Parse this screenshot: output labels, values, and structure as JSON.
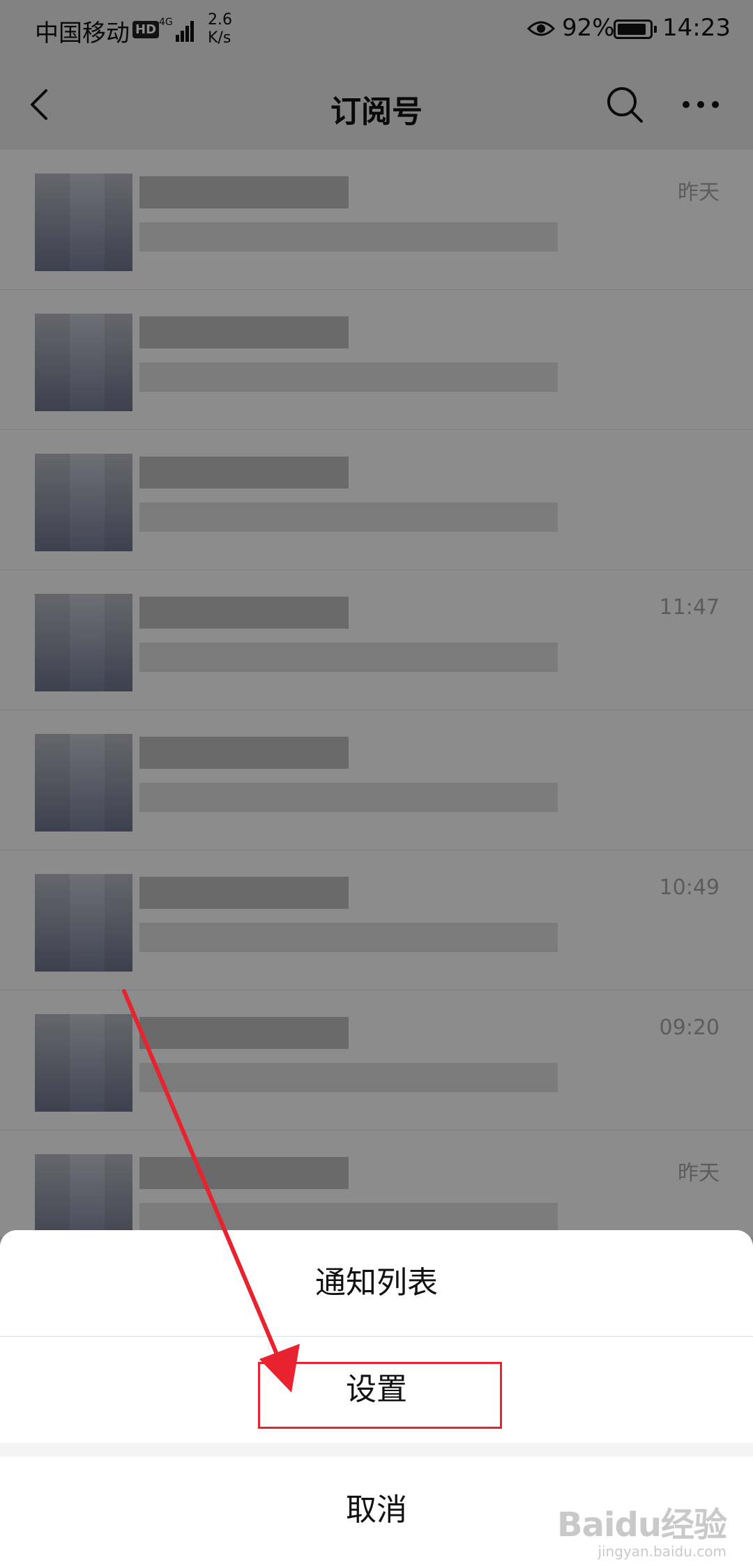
{
  "status_bar": {
    "carrier": "中国移动",
    "hd_badge": "HD",
    "network": "4G",
    "speed_value": "2.6",
    "speed_unit": "K/s",
    "battery": "92%",
    "battery_level": 0.92,
    "time": "14:23"
  },
  "nav": {
    "title": "订阅号"
  },
  "list": {
    "items": [
      {
        "time": "昨天"
      },
      {
        "time": ""
      },
      {
        "time": ""
      },
      {
        "time": "11:47"
      },
      {
        "time": ""
      },
      {
        "time": "10:49"
      },
      {
        "time": "09:20"
      },
      {
        "time": "昨天"
      }
    ]
  },
  "action_sheet": {
    "notification_list": "通知列表",
    "settings": "设置",
    "cancel": "取消"
  },
  "watermark": {
    "brand": "Baidu经验",
    "url": "jingyan.baidu.com"
  },
  "colors": {
    "annotation_red": "#e8232f"
  }
}
